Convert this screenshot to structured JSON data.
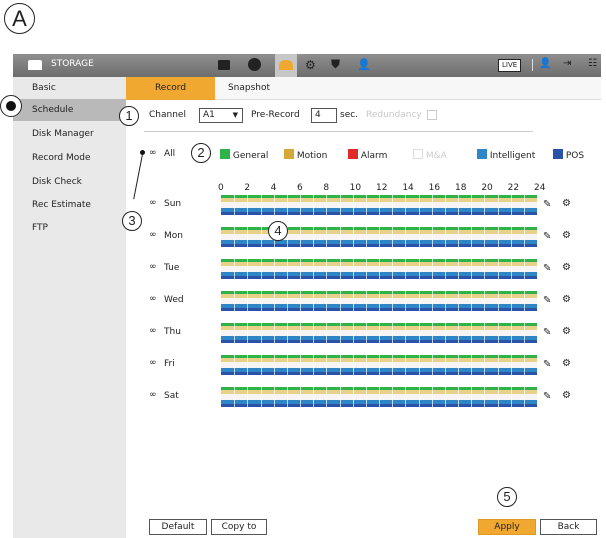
{
  "figure_label": "A",
  "callouts": [
    "1",
    "2",
    "3",
    "4",
    "5"
  ],
  "topbar": {
    "section_title": "STORAGE",
    "live_badge": "LIVE"
  },
  "sidebar": {
    "items": [
      {
        "label": "Basic"
      },
      {
        "label": "Schedule"
      },
      {
        "label": "Disk Manager"
      },
      {
        "label": "Record Mode"
      },
      {
        "label": "Disk Check"
      },
      {
        "label": "Rec Estimate"
      },
      {
        "label": "FTP"
      }
    ]
  },
  "tabs": [
    {
      "label": "Record",
      "active": true
    },
    {
      "label": "Snapshot",
      "active": false
    }
  ],
  "form": {
    "channel_label": "Channel",
    "channel_value": "A1",
    "prerecord_label": "Pre-Record",
    "prerecord_value": "4",
    "prerecord_unit": "sec.",
    "redundancy_label": "Redundancy"
  },
  "legend": {
    "all_label": "All",
    "items": [
      {
        "label": "General",
        "color": "#2db34a"
      },
      {
        "label": "Motion",
        "color": "#d4a93a"
      },
      {
        "label": "Alarm",
        "color": "#e02b2b"
      },
      {
        "label": "M&A",
        "color": "#dddddd"
      },
      {
        "label": "Intelligent",
        "color": "#2f86c6"
      },
      {
        "label": "POS",
        "color": "#2a52a8"
      }
    ]
  },
  "hours": [
    "0",
    "2",
    "4",
    "6",
    "8",
    "10",
    "12",
    "14",
    "16",
    "18",
    "20",
    "22",
    "24"
  ],
  "days": [
    {
      "label": "Sun"
    },
    {
      "label": "Mon"
    },
    {
      "label": "Tue"
    },
    {
      "label": "Wed"
    },
    {
      "label": "Thu"
    },
    {
      "label": "Fri"
    },
    {
      "label": "Sat"
    }
  ],
  "buttons": {
    "default": "Default",
    "copy_to": "Copy to",
    "apply": "Apply",
    "back": "Back"
  }
}
